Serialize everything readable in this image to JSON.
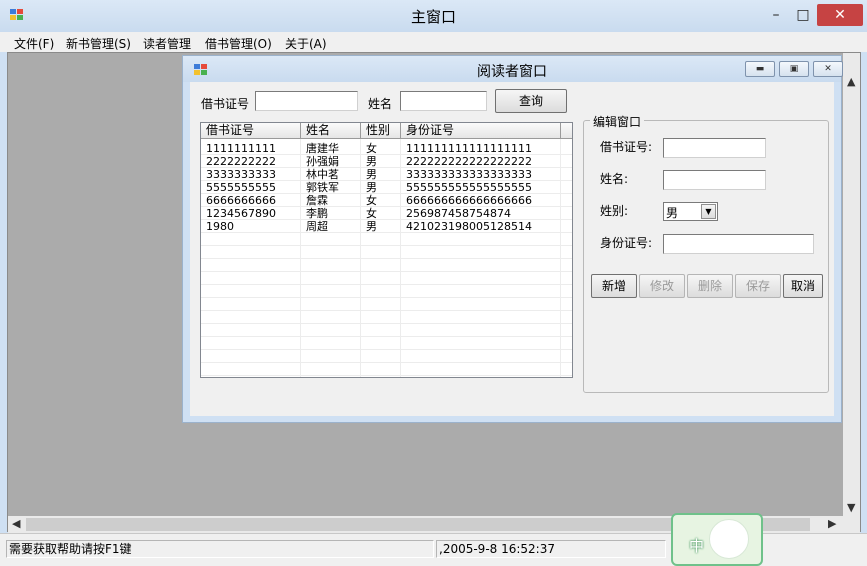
{
  "main_window": {
    "title": "主窗口",
    "controls": {
      "minimize": "–",
      "maximize": "□",
      "close": "✕"
    }
  },
  "menu": [
    {
      "label": "文件(F)"
    },
    {
      "label": "新书管理(S)"
    },
    {
      "label": "读者管理"
    },
    {
      "label": "借书管理(O)"
    },
    {
      "label": "关于(A)"
    }
  ],
  "child_window": {
    "title": "阅读者窗口",
    "controls": {
      "minimize": "▬",
      "restore": "▣",
      "close": "✕"
    }
  },
  "search": {
    "card_label": "借书证号",
    "card_value": "",
    "name_label": "姓名",
    "name_value": "",
    "query_button": "查询"
  },
  "grid": {
    "columns": [
      "借书证号",
      "姓名",
      "性别",
      "身份证号"
    ],
    "rows": [
      [
        "1111111111",
        "唐建华",
        "女",
        "111111111111111111"
      ],
      [
        "2222222222",
        "孙强娟",
        "男",
        "222222222222222222"
      ],
      [
        "3333333333",
        "林中茗",
        "男",
        "333333333333333333"
      ],
      [
        "5555555555",
        "郭铁军",
        "男",
        "555555555555555555"
      ],
      [
        "6666666666",
        "詹霖",
        "女",
        "666666666666666666"
      ],
      [
        "1234567890",
        "李鹏",
        "女",
        "256987458754874"
      ],
      [
        "1980",
        "周超",
        "男",
        "421023198005128514"
      ]
    ]
  },
  "edit_panel": {
    "title": "编辑窗口",
    "card_label": "借书证号:",
    "card_value": "",
    "name_label": "姓名:",
    "name_value": "",
    "gender_label": "姓别:",
    "gender_value": "男",
    "id_label": "身份证号:",
    "id_value": "",
    "buttons": {
      "add": "新增",
      "modify": "修改",
      "delete": "删除",
      "save": "保存",
      "cancel": "取消"
    }
  },
  "status_bar": {
    "help": "需要获取帮助请按F1键",
    "datetime": ",2005-9-8 16:52:37"
  },
  "ime": {
    "mode": "中"
  },
  "colors": {
    "titlebar": "#cfe0f3",
    "mdi_background": "#ababab",
    "close_button": "#c64343",
    "ime_border": "#6fc18a"
  }
}
